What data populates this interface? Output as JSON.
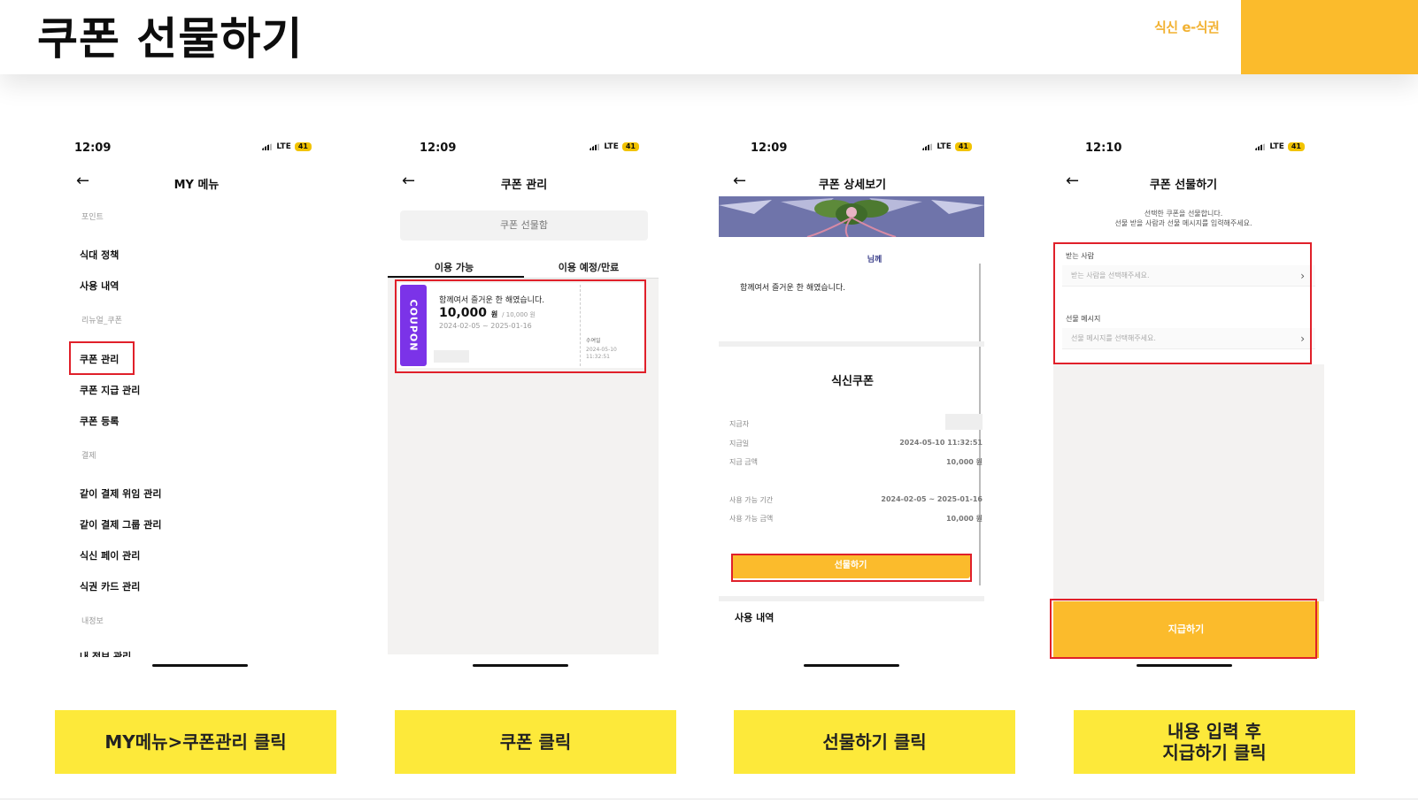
{
  "page": {
    "title": "쿠폰 선물하기",
    "brand": "식신 e-식권",
    "accent_color": "#fbbb2c",
    "caption_color": "#fde93a",
    "highlight_color": "#e0202a"
  },
  "status": {
    "battery": "41",
    "network": "LTE"
  },
  "screen1": {
    "time": "12:09",
    "nav_title": "MY 메뉴",
    "sections": {
      "point": "포인트",
      "renewal": "리뉴얼_쿠폰",
      "payment": "결제",
      "myinfo": "내정보"
    },
    "items": {
      "meal_policy": "식대 정책",
      "usage_history": "사용 내역",
      "coupon_manage": "쿠폰 관리",
      "coupon_issue_manage": "쿠폰 지급 관리",
      "coupon_register": "쿠폰 등록",
      "joint_delegate": "같이 결제 위임 관리",
      "joint_group": "같이 결제 그룹 관리",
      "sikshin_pay": "식신 페이 관리",
      "meal_card": "식권 카드 관리",
      "my_info": "내 정보 관리"
    }
  },
  "screen2": {
    "time": "12:09",
    "nav_title": "쿠폰 관리",
    "gift_box": "쿠폰 선물함",
    "tabs": [
      "이용 가능",
      "이용 예정/만료"
    ],
    "coupon": {
      "ribbon": "COUPON",
      "name": "함께여서 즐거운 한 해였습니다.",
      "amount": "10,000",
      "unit": "원",
      "total": "/ 10,000 원",
      "period": "2024-02-05 ~ 2025-01-16",
      "received_label": "수여일",
      "received_date": "2024-05-10 11:32:51"
    }
  },
  "screen3": {
    "time": "12:09",
    "nav_title": "쿠폰 상세보기",
    "recipient": "님께",
    "message": "함께여서 즐거운 한 해였습니다.",
    "coupon_title": "식신쿠폰",
    "rows": {
      "issuer_label": "지급자",
      "issue_date_label": "지급일",
      "issue_date": "2024-05-10 11:32:51",
      "issue_amount_label": "지급 금액",
      "issue_amount": "10,000 원",
      "period_label": "사용 가능 기간",
      "period": "2024-02-05 ~ 2025-01-16",
      "usable_label": "사용 가능 금액",
      "usable": "10,000 원"
    },
    "gift_button": "선물하기",
    "history": "사용 내역"
  },
  "screen4": {
    "time": "12:10",
    "nav_title": "쿠폰 선물하기",
    "intro_line1": "선택한 쿠폰을 선물합니다.",
    "intro_line2": "선물 받을 사람과 선물 메시지를 입력해주세요.",
    "receiver_label": "받는 사람",
    "receiver_placeholder": "받는 사람을 선택해주세요.",
    "message_label": "선물 메시지",
    "message_placeholder": "선물 메시지를 선택해주세요.",
    "issue_button": "지급하기"
  },
  "captions": {
    "step1": "MY메뉴>쿠폰관리 클릭",
    "step2": "쿠폰 클릭",
    "step3": "선물하기 클릭",
    "step4_line1": "내용 입력 후",
    "step4_line2": "지급하기 클릭"
  }
}
